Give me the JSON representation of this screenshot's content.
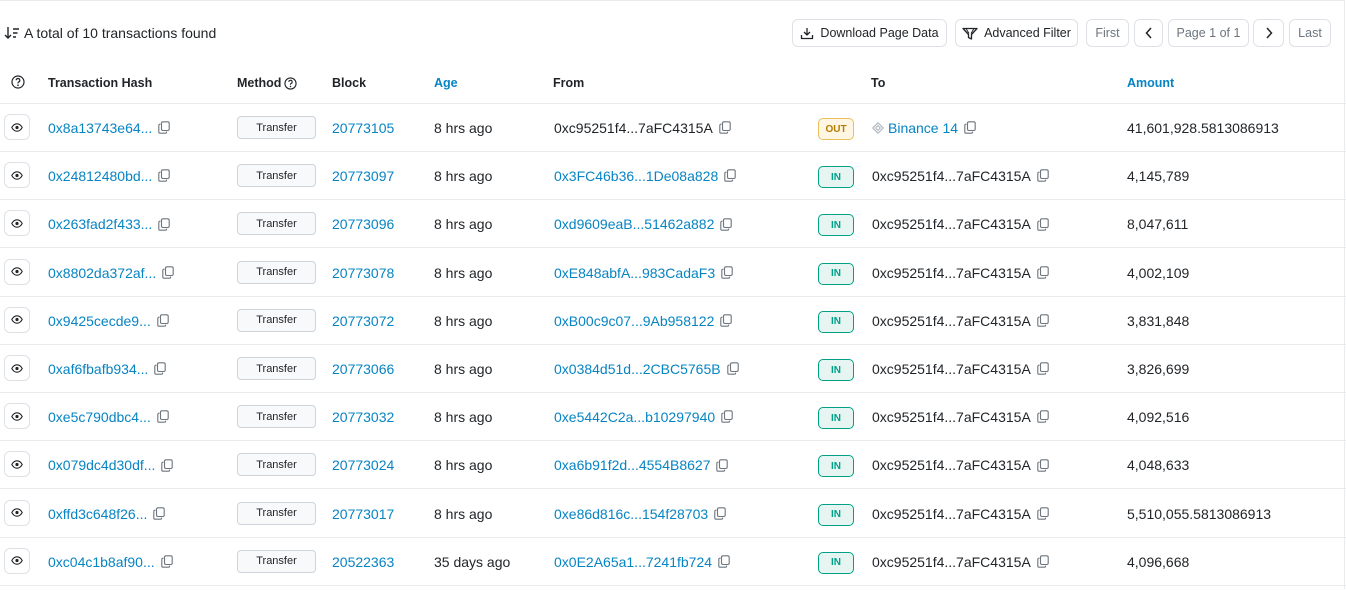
{
  "summary": "A total of 10 transactions found",
  "toolbar": {
    "download_label": "Download Page Data",
    "filter_label": "Advanced Filter",
    "first_label": "First",
    "page_label": "Page 1 of 1",
    "last_label": "Last"
  },
  "columns": {
    "hash": "Transaction Hash",
    "method": "Method",
    "block": "Block",
    "age": "Age",
    "from": "From",
    "to": "To",
    "amount": "Amount"
  },
  "rows": [
    {
      "hash": "0x8a13743e64...",
      "method": "Transfer",
      "block": "20773105",
      "age": "8 hrs ago",
      "from": "0xc95251f4...7aFC4315A",
      "dir": "OUT",
      "to": "Binance 14",
      "amount": "41,601,928.5813086913"
    },
    {
      "hash": "0x24812480bd...",
      "method": "Transfer",
      "block": "20773097",
      "age": "8 hrs ago",
      "from": "0x3FC46b36...1De08a828",
      "dir": "IN",
      "to": "0xc95251f4...7aFC4315A",
      "amount": "4,145,789"
    },
    {
      "hash": "0x263fad2f433...",
      "method": "Transfer",
      "block": "20773096",
      "age": "8 hrs ago",
      "from": "0xd9609eaB...51462a882",
      "dir": "IN",
      "to": "0xc95251f4...7aFC4315A",
      "amount": "8,047,611"
    },
    {
      "hash": "0x8802da372af...",
      "method": "Transfer",
      "block": "20773078",
      "age": "8 hrs ago",
      "from": "0xE848abfA...983CadaF3",
      "dir": "IN",
      "to": "0xc95251f4...7aFC4315A",
      "amount": "4,002,109"
    },
    {
      "hash": "0x9425cecde9...",
      "method": "Transfer",
      "block": "20773072",
      "age": "8 hrs ago",
      "from": "0xB00c9c07...9Ab958122",
      "dir": "IN",
      "to": "0xc95251f4...7aFC4315A",
      "amount": "3,831,848"
    },
    {
      "hash": "0xaf6fbafb934...",
      "method": "Transfer",
      "block": "20773066",
      "age": "8 hrs ago",
      "from": "0x0384d51d...2CBC5765B",
      "dir": "IN",
      "to": "0xc95251f4...7aFC4315A",
      "amount": "3,826,699"
    },
    {
      "hash": "0xe5c790dbc4...",
      "method": "Transfer",
      "block": "20773032",
      "age": "8 hrs ago",
      "from": "0xe5442C2a...b10297940",
      "dir": "IN",
      "to": "0xc95251f4...7aFC4315A",
      "amount": "4,092,516"
    },
    {
      "hash": "0x079dc4d30df...",
      "method": "Transfer",
      "block": "20773024",
      "age": "8 hrs ago",
      "from": "0xa6b91f2d...4554B8627",
      "dir": "IN",
      "to": "0xc95251f4...7aFC4315A",
      "amount": "4,048,633"
    },
    {
      "hash": "0xffd3c648f26...",
      "method": "Transfer",
      "block": "20773017",
      "age": "8 hrs ago",
      "from": "0xe86d816c...154f28703",
      "dir": "IN",
      "to": "0xc95251f4...7aFC4315A",
      "amount": "5,510,055.5813086913"
    },
    {
      "hash": "0xc04c1b8af90...",
      "method": "Transfer",
      "block": "20522363",
      "age": "35 days ago",
      "from": "0x0E2A65a1...7241fb724",
      "dir": "IN",
      "to": "0xc95251f4...7aFC4315A",
      "amount": "4,096,668"
    }
  ],
  "icons": {
    "eye": "eye-icon",
    "copy": "copy-icon",
    "binance": "binance-icon",
    "download": "download-icon",
    "filter": "filter-icon",
    "help": "question-circle-icon",
    "sort": "sort-desc-icon"
  },
  "colors": {
    "link": "#0784c3",
    "in_badge": "#00a186",
    "out_badge": "#b47d00",
    "border": "#e9ecef"
  }
}
